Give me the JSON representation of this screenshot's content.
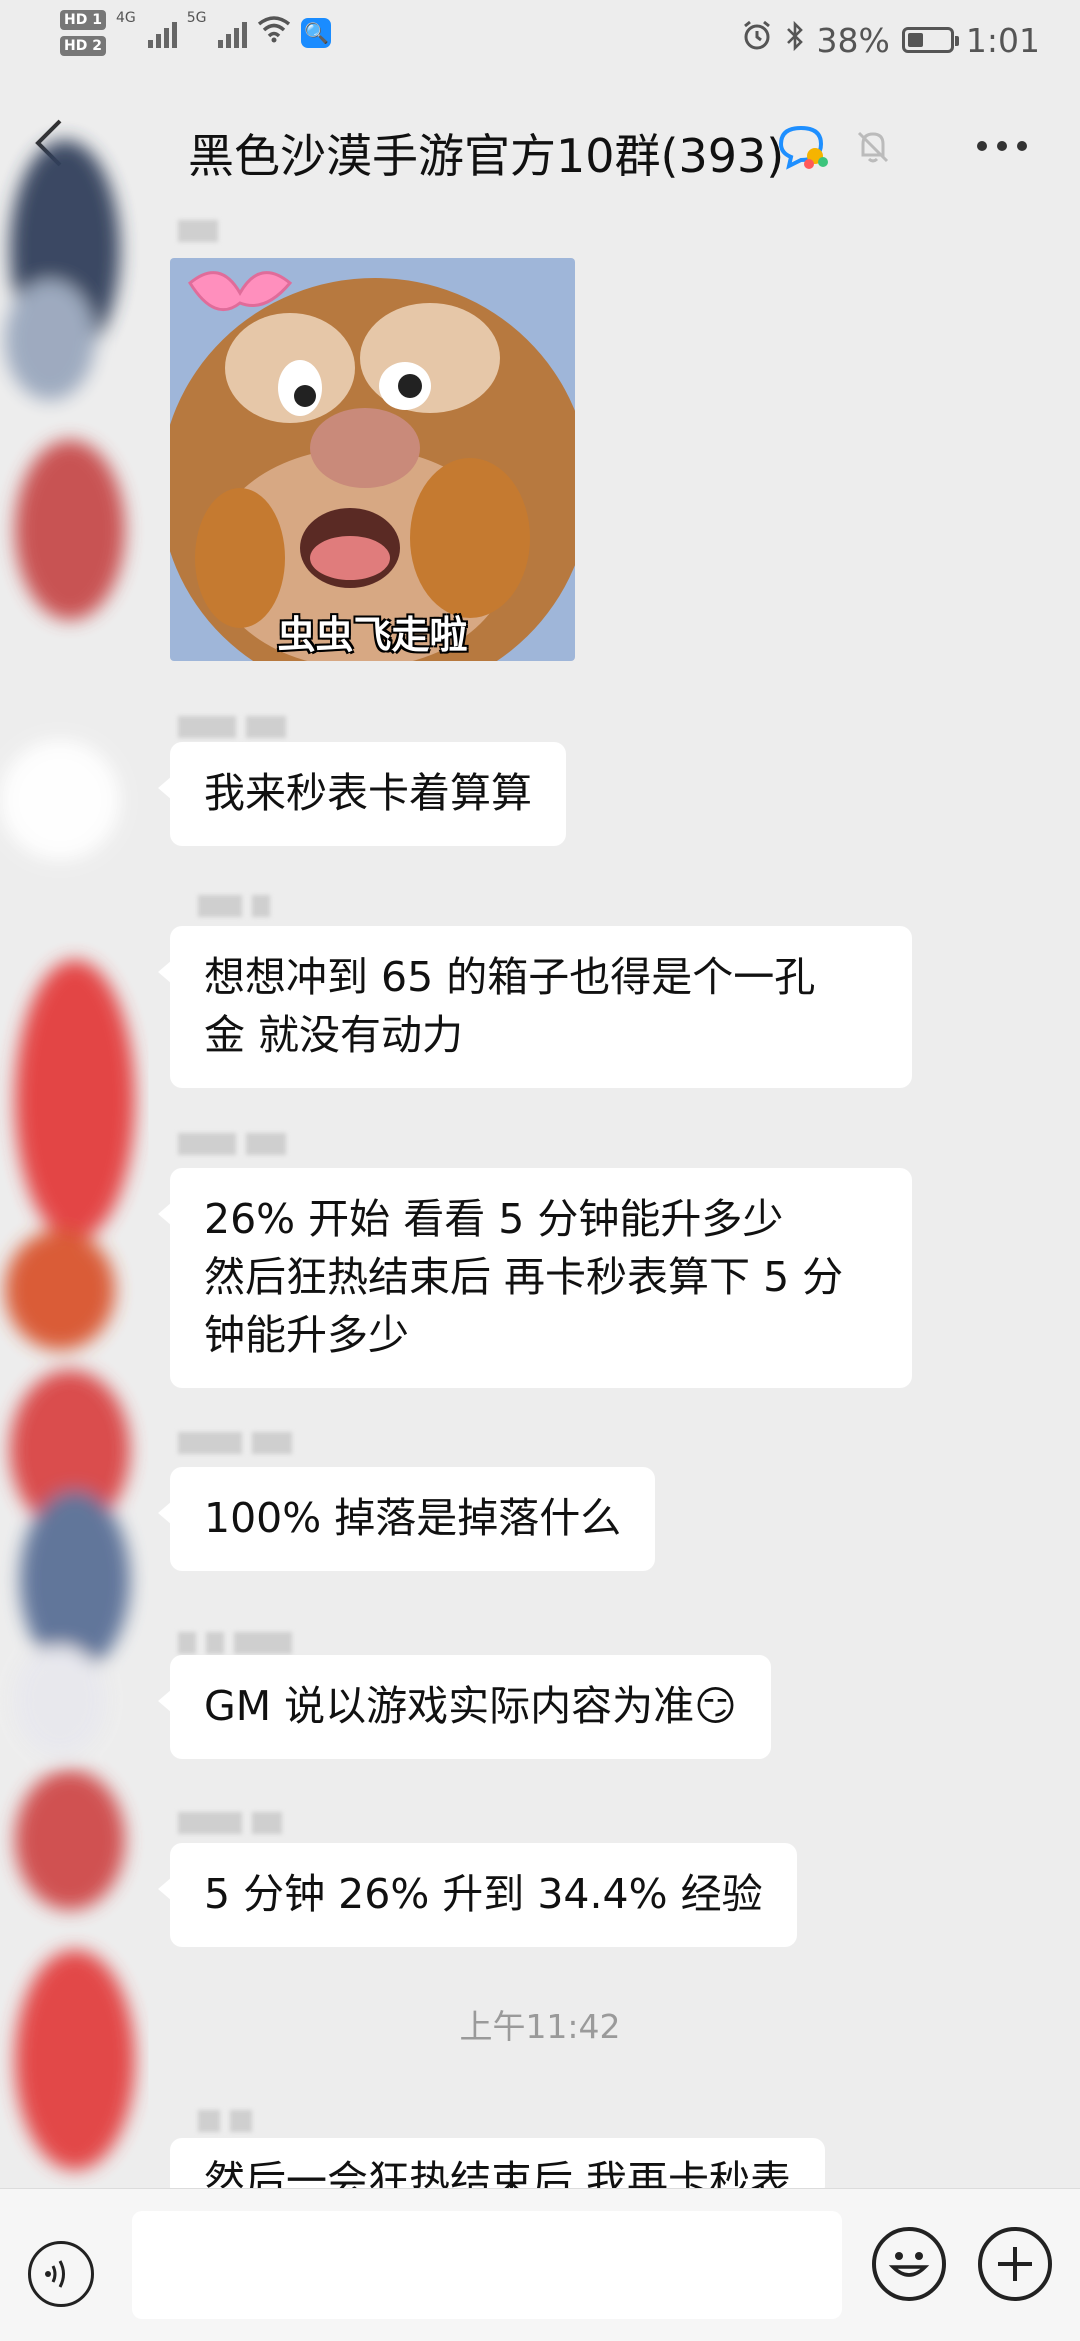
{
  "status_bar": {
    "hd1": "HD 1",
    "hd2": "HD 2",
    "net1": "4G",
    "net2": "5G",
    "battery": "38%",
    "battery_level": 0.38,
    "time": "1:01",
    "icons": [
      "signal-icon",
      "wifi-icon",
      "app-notification-icon",
      "alarm-icon",
      "bluetooth-icon",
      "battery-icon"
    ]
  },
  "header": {
    "title": "黑色沙漠手游官方10群(393)",
    "icons": [
      "back-icon",
      "group-chat-icon",
      "muted-bell-icon",
      "more-icon"
    ]
  },
  "messages": [
    {
      "type": "sticker",
      "caption": "虫虫飞走啦"
    },
    {
      "type": "text",
      "text": "我来秒表卡着算算"
    },
    {
      "type": "text",
      "text": "想想冲到 65 的箱子也得是个一孔\n金 就没有动力"
    },
    {
      "type": "text",
      "text": "26% 开始   看看 5 分钟能升多少\n然后狂热结束后 再卡秒表算下 5 分\n钟能升多少"
    },
    {
      "type": "text",
      "text": "100% 掉落是掉落什么"
    },
    {
      "type": "text",
      "text": "GM 说以游戏实际内容为准😏"
    },
    {
      "type": "text",
      "text": "5 分钟  26% 升到 34.4% 经验"
    },
    {
      "type": "text",
      "text": "然后一会狂热结束后 我再卡秒表"
    }
  ],
  "timestamp": "上午11:42",
  "input_bar": {
    "placeholder": "",
    "icons": [
      "voice-icon",
      "emoji-icon",
      "plus-icon"
    ]
  }
}
